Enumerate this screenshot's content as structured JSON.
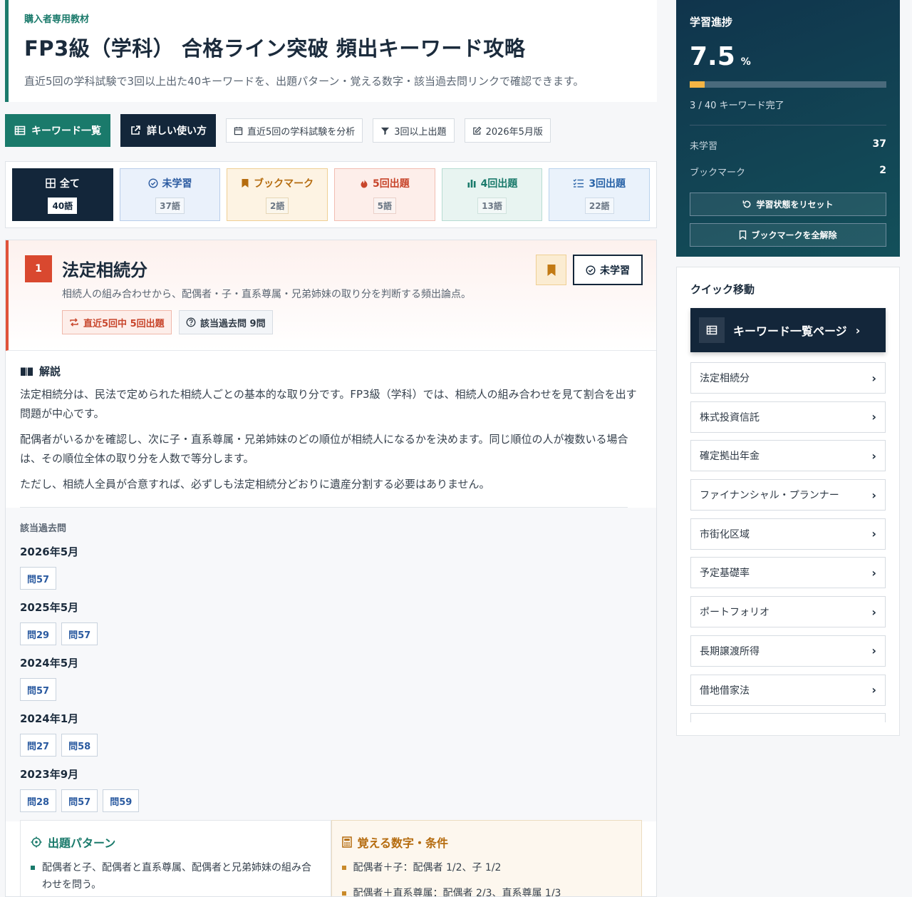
{
  "header": {
    "eyebrow": "購入者専用教材",
    "title": "FP3級（学科） 合格ライン突破 頻出キーワード攻略",
    "subtitle": "直近5回の学科試験で3回以上出た40キーワードを、出題パターン・覚える数字・該当過去問リンクで確認できます。"
  },
  "toolbar": {
    "keyword_list_label": "キーワード一覧",
    "howto_label": "詳しい使い方",
    "chips": [
      "直近5回の学科試験を分析",
      "3回以上出題",
      "2026年5月版"
    ]
  },
  "filters": [
    {
      "label": "全て",
      "count": "40語",
      "icon": "grid-icon"
    },
    {
      "label": "未学習",
      "count": "37語",
      "icon": "check-circle-icon"
    },
    {
      "label": "ブックマーク",
      "count": "2語",
      "icon": "bookmark-icon"
    },
    {
      "label": "5回出題",
      "count": "5語",
      "icon": "flame-icon"
    },
    {
      "label": "4回出題",
      "count": "13語",
      "icon": "bar-chart-icon"
    },
    {
      "label": "3回出題",
      "count": "22語",
      "icon": "list-check-icon"
    }
  ],
  "keyword": {
    "number": "1",
    "title": "法定相続分",
    "summary": "相続人の組み合わせから、配偶者・子・直系尊属・兄弟姉妹の取り分を判断する頻出論点。",
    "freq_badge": "直近5回中 5回出題",
    "past_badge": "該当過去問 9問",
    "status_label": "未学習",
    "explain_heading": "解説",
    "paragraphs": [
      "法定相続分は、民法で定められた相続人ごとの基本的な取り分です。FP3級（学科）では、相続人の組み合わせを見て割合を出す問題が中心です。",
      "配偶者がいるかを確認し、次に子・直系尊属・兄弟姉妹のどの順位が相続人になるかを決めます。同じ順位の人が複数いる場合は、その順位全体の取り分を人数で等分します。",
      "ただし、相続人全員が合意すれば、必ずしも法定相続分どおりに遺産分割する必要はありません。"
    ],
    "past_label": "該当過去問",
    "past_exams": [
      {
        "date": "2026年5月",
        "questions": [
          "問57"
        ]
      },
      {
        "date": "2025年5月",
        "questions": [
          "問29",
          "問57"
        ]
      },
      {
        "date": "2024年5月",
        "questions": [
          "問57"
        ]
      },
      {
        "date": "2024年1月",
        "questions": [
          "問27",
          "問58"
        ]
      },
      {
        "date": "2023年9月",
        "questions": [
          "問28",
          "問57",
          "問59"
        ]
      }
    ],
    "pattern_heading": "出題パターン",
    "pattern_items": [
      "配偶者と子、配偶者と直系尊属、配偶者と兄弟姉妹の組み合わせを問う。"
    ],
    "memo_heading": "覚える数字・条件",
    "memo_items": [
      "配偶者＋子：配偶者 1/2、子 1/2",
      "配偶者＋直系尊属：配偶者 2/3、直系尊属 1/3"
    ]
  },
  "progress": {
    "heading": "学習進捗",
    "percent": "7.5",
    "unit": "%",
    "fill_fraction": 0.075,
    "done_text": "3 / 40 キーワード完了",
    "stats": [
      {
        "label": "未学習",
        "value": "37"
      },
      {
        "label": "ブックマーク",
        "value": "2"
      }
    ],
    "reset_label": "学習状態をリセット",
    "clear_bookmarks_label": "ブックマークを全解除"
  },
  "quick_nav": {
    "heading": "クイック移動",
    "keyword_page_label": "キーワード一覧ページ",
    "items": [
      "法定相続分",
      "株式投資信託",
      "確定拠出年金",
      "ファイナンシャル・プランナー",
      "市街化区域",
      "予定基礎率",
      "ポートフォリオ",
      "長期譲渡所得",
      "借地借家法"
    ]
  },
  "colors": {
    "teal": "#1a7a6b",
    "navy": "#13263a",
    "accent_red": "#d9482f",
    "accent_orange": "#f5b544"
  }
}
